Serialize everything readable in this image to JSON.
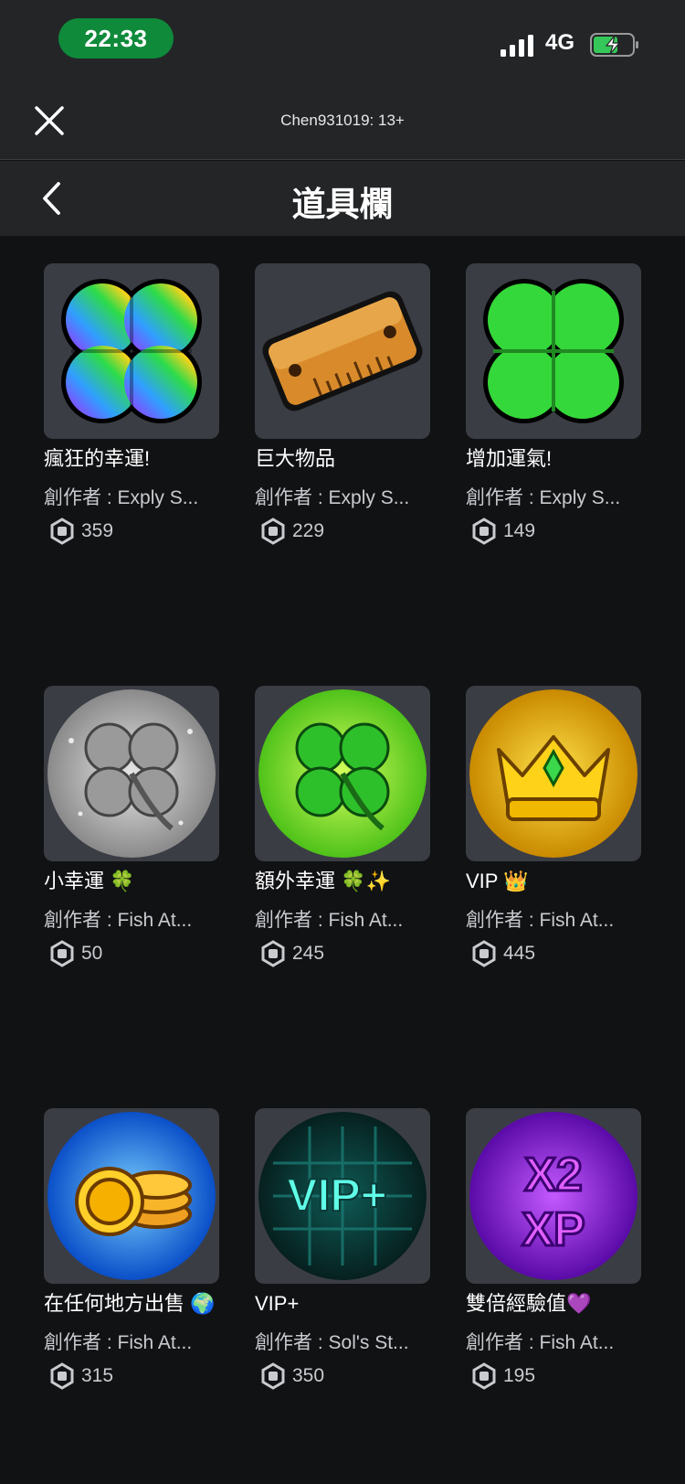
{
  "status_bar": {
    "time": "22:33",
    "network": "4G"
  },
  "header": {
    "user_label": "Chen931019: 13+"
  },
  "title_bar": {
    "title": "道具欄"
  },
  "items": [
    {
      "name": "瘋狂的幸運!",
      "creator": "創作者 : Exply S...",
      "price": "359",
      "icon": "rainbow-clover-icon"
    },
    {
      "name": "巨大物品",
      "creator": "創作者 : Exply S...",
      "price": "229",
      "icon": "ruler-icon"
    },
    {
      "name": "增加運氣!",
      "creator": "創作者 : Exply S...",
      "price": "149",
      "icon": "green-clover-icon"
    },
    {
      "name": "小幸運 🍀",
      "creator": "創作者 : Fish At...",
      "price": "50",
      "icon": "silver-clover-icon"
    },
    {
      "name": "額外幸運 🍀✨",
      "creator": "創作者 : Fish At...",
      "price": "245",
      "icon": "lucky-clover-icon"
    },
    {
      "name": "VIP 👑",
      "creator": "創作者 : Fish At...",
      "price": "445",
      "icon": "crown-icon"
    },
    {
      "name": "在任何地方出售 🌍",
      "creator": "創作者 : Fish At...",
      "price": "315",
      "icon": "coins-icon"
    },
    {
      "name": "VIP+",
      "creator": "創作者 : Sol's St...",
      "price": "350",
      "icon": "vip-plus-icon"
    },
    {
      "name": "雙倍經驗值💜",
      "creator": "創作者 : Fish At...",
      "price": "195",
      "icon": "x2-xp-icon"
    }
  ]
}
